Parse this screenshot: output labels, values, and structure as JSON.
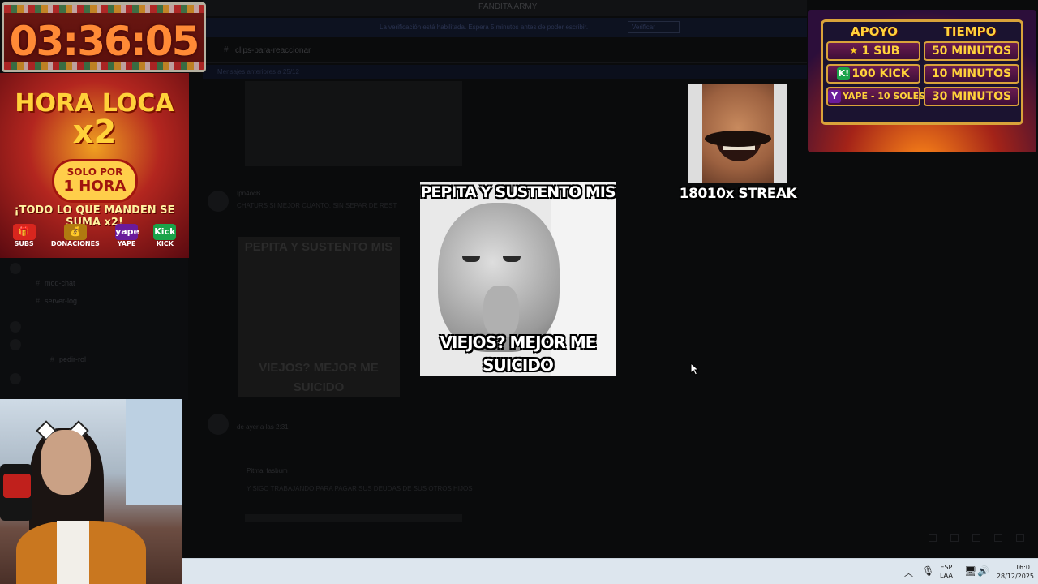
{
  "background_app": {
    "title": "PANDITA ARMY",
    "notice_text": "La verificación está habilitada. Espera 5 minutos antes de poder escribir.",
    "notice_button": "Verificar",
    "channel_name": "clips-para-reaccionar",
    "pinned_bar": "Mensajes anteriores a 25/12",
    "sidebar_items": [
      "mod-chat",
      "server-log",
      "pedir-rol"
    ],
    "message_author": "Ipn4ocB",
    "message_text": "CHATURS SI MEJOR CUANTO, SIN SEPAR DE REST",
    "chat_meme_top": "PEPITA Y SUSTENTO MIS",
    "chat_meme_bottom": "VIEJOS? MEJOR ME SUICIDO",
    "second_author": "de ayer a las 2:31",
    "reply_name": "Pitmal fasbum",
    "reply_text": "Y SIGO TRABAJANDO PARA PAGAR SUS DEUDAS DE SUS OTROS HIJOS"
  },
  "overlays": {
    "timer": "03:36:05",
    "hora_loca": {
      "title_line1": "HORA LOCA",
      "title_line2": "x2",
      "solo_line1": "SOLO POR",
      "solo_line2": "1 HORA",
      "tagline": "¡TODO LO QUE MANDEN SE SUMA x2!",
      "icons": [
        {
          "label": "SUBS",
          "glyph": "🎁",
          "color": "#d8261e"
        },
        {
          "label": "DONACIONES",
          "glyph": "💰",
          "color": "#b07a10"
        },
        {
          "label": "YAPE",
          "glyph": "yape",
          "color": "#6a1b9a"
        },
        {
          "label": "KICK",
          "glyph": "Kick",
          "color": "#1aa34a"
        }
      ]
    },
    "meme": {
      "top_text": "PEPITA Y SUSTENTO MIS",
      "bottom_text": "VIEJOS? MEJOR ME SUICIDO"
    },
    "streak": {
      "label": "18010x STREAK"
    },
    "support_table": {
      "header_left": "APOYO",
      "header_right": "TIEMPO",
      "rows": [
        {
          "left": "1 SUB",
          "left_icon": "★",
          "left_icon_color": "#ffcc22",
          "right": "50 MINUTOS"
        },
        {
          "left": "100 KICK",
          "left_icon": "K!",
          "left_icon_color": "#1aa34a",
          "right": "10 MINUTOS"
        },
        {
          "left": "YAPE - 10 SOLES",
          "left_icon": "Y",
          "left_icon_color": "#6a1b9a",
          "right": "30 MINUTOS"
        }
      ]
    }
  },
  "taskbar": {
    "lang_line1": "ESP",
    "lang_line2": "LAA",
    "time": "16:01",
    "date": "28/12/2025"
  },
  "colors": {
    "timer_text": "#ff8a36",
    "taskbar_bg": "#dde6ee",
    "gold": "#ffd23a"
  }
}
